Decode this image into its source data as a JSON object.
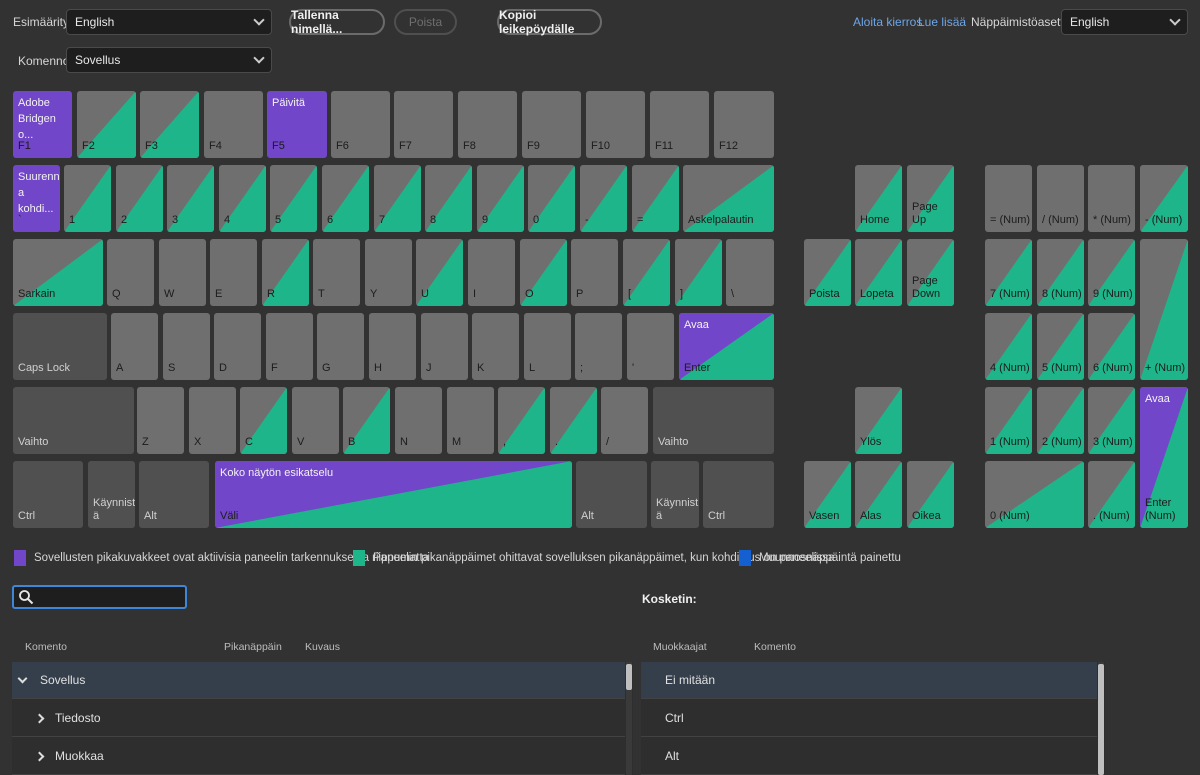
{
  "header": {
    "preset_label": "Esimääritys:",
    "preset_value": "English",
    "save_as_label": "Tallenna nimellä...",
    "delete_label": "Poista",
    "copy_label": "Kopioi leikepöydälle",
    "commands_label": "Komennot:",
    "commands_value": "Sovellus",
    "tour_link": "Aloita kierros",
    "learn_more_link": "Lue lisää",
    "layout_label": "Näppäimistöasettelu:",
    "layout_value": "English"
  },
  "colors": {
    "app_shortcut": "#7246c8",
    "panel_shortcut": "#1fb58a",
    "modifier": "#1560d0",
    "key": "#6f6f6f",
    "mod_key": "#505050"
  },
  "keyboard": {
    "keys": [
      {
        "id": "f1",
        "label": "F1",
        "command": "Adobe\nBridgen o...",
        "type": "purple"
      },
      {
        "id": "f2",
        "label": "F2",
        "type": "green-diag"
      },
      {
        "id": "f3",
        "label": "F3",
        "type": "green-diag"
      },
      {
        "id": "f4",
        "label": "F4",
        "type": "plain"
      },
      {
        "id": "f5",
        "label": "F5",
        "command": "Päivitä",
        "type": "purple"
      },
      {
        "id": "f6",
        "label": "F6",
        "type": "plain"
      },
      {
        "id": "f7",
        "label": "F7",
        "type": "plain"
      },
      {
        "id": "f8",
        "label": "F8",
        "type": "plain"
      },
      {
        "id": "f9",
        "label": "F9",
        "type": "plain"
      },
      {
        "id": "f10",
        "label": "F10",
        "type": "plain"
      },
      {
        "id": "f11",
        "label": "F11",
        "type": "plain"
      },
      {
        "id": "f12",
        "label": "F12",
        "type": "plain"
      },
      {
        "id": "backtick",
        "label": "`",
        "command": "Suurenn\na\nkohdi...",
        "type": "purple"
      },
      {
        "id": "1",
        "label": "1",
        "type": "green-diag"
      },
      {
        "id": "2",
        "label": "2",
        "type": "green-diag"
      },
      {
        "id": "3",
        "label": "3",
        "type": "green-diag"
      },
      {
        "id": "4",
        "label": "4",
        "type": "green-diag"
      },
      {
        "id": "5",
        "label": "5",
        "type": "green-diag"
      },
      {
        "id": "6",
        "label": "6",
        "type": "green-diag"
      },
      {
        "id": "7",
        "label": "7",
        "type": "green-diag"
      },
      {
        "id": "8",
        "label": "8",
        "type": "green-diag"
      },
      {
        "id": "9",
        "label": "9",
        "type": "green-diag"
      },
      {
        "id": "0",
        "label": "0",
        "type": "green-diag"
      },
      {
        "id": "minus",
        "label": "-",
        "type": "green-diag"
      },
      {
        "id": "equals",
        "label": "=",
        "type": "green-diag"
      },
      {
        "id": "backspace",
        "label": "Askelpalautin",
        "type": "green-diag"
      },
      {
        "id": "tab",
        "label": "Sarkain",
        "type": "green-diag"
      },
      {
        "id": "q",
        "label": "Q",
        "type": "plain"
      },
      {
        "id": "w",
        "label": "W",
        "type": "plain"
      },
      {
        "id": "e",
        "label": "E",
        "type": "plain"
      },
      {
        "id": "r",
        "label": "R",
        "type": "green-diag"
      },
      {
        "id": "t",
        "label": "T",
        "type": "plain"
      },
      {
        "id": "y",
        "label": "Y",
        "type": "plain"
      },
      {
        "id": "u",
        "label": "U",
        "type": "green-diag"
      },
      {
        "id": "i",
        "label": "I",
        "type": "plain"
      },
      {
        "id": "o",
        "label": "O",
        "type": "green-diag"
      },
      {
        "id": "p",
        "label": "P",
        "type": "plain"
      },
      {
        "id": "lbracket",
        "label": "[",
        "type": "green-diag"
      },
      {
        "id": "rbracket",
        "label": "]",
        "type": "green-diag"
      },
      {
        "id": "backslash",
        "label": "\\",
        "type": "plain"
      },
      {
        "id": "capslock",
        "label": "Caps Lock",
        "type": "mod"
      },
      {
        "id": "a",
        "label": "A",
        "type": "plain"
      },
      {
        "id": "s",
        "label": "S",
        "type": "plain"
      },
      {
        "id": "d",
        "label": "D",
        "type": "plain"
      },
      {
        "id": "f",
        "label": "F",
        "type": "plain"
      },
      {
        "id": "g",
        "label": "G",
        "type": "plain"
      },
      {
        "id": "h",
        "label": "H",
        "type": "plain"
      },
      {
        "id": "j",
        "label": "J",
        "type": "plain"
      },
      {
        "id": "k",
        "label": "K",
        "type": "plain"
      },
      {
        "id": "l",
        "label": "L",
        "type": "plain"
      },
      {
        "id": "semicolon",
        "label": ";",
        "type": "plain"
      },
      {
        "id": "quote",
        "label": "'",
        "type": "plain"
      },
      {
        "id": "enter",
        "label": "Enter",
        "command": "Avaa",
        "type": "purple-green"
      },
      {
        "id": "lshift",
        "label": "Vaihto",
        "type": "mod"
      },
      {
        "id": "z",
        "label": "Z",
        "type": "plain"
      },
      {
        "id": "x",
        "label": "X",
        "type": "plain"
      },
      {
        "id": "c",
        "label": "C",
        "type": "green-diag"
      },
      {
        "id": "v",
        "label": "V",
        "type": "plain"
      },
      {
        "id": "b",
        "label": "B",
        "type": "green-diag"
      },
      {
        "id": "n",
        "label": "N",
        "type": "plain"
      },
      {
        "id": "m",
        "label": "M",
        "type": "plain"
      },
      {
        "id": "comma",
        "label": ",",
        "type": "green-diag"
      },
      {
        "id": "period",
        "label": ".",
        "type": "green-diag"
      },
      {
        "id": "slash",
        "label": "/",
        "type": "plain"
      },
      {
        "id": "rshift",
        "label": "Vaihto",
        "type": "mod"
      },
      {
        "id": "lctrl",
        "label": "Ctrl",
        "type": "mod"
      },
      {
        "id": "lwin",
        "label": "Käynnist\nä",
        "type": "mod"
      },
      {
        "id": "lalt",
        "label": "Alt",
        "type": "mod"
      },
      {
        "id": "space",
        "label": "Väli",
        "command": "Koko näytön esikatselu",
        "type": "purple-green"
      },
      {
        "id": "ralt",
        "label": "Alt",
        "type": "mod"
      },
      {
        "id": "rwin",
        "label": "Käynnist\nä",
        "type": "mod"
      },
      {
        "id": "rctrl",
        "label": "Ctrl",
        "type": "mod"
      },
      {
        "id": "home",
        "label": "Home",
        "type": "green-diag"
      },
      {
        "id": "pageup",
        "label": "Page Up",
        "type": "green-diag"
      },
      {
        "id": "delete",
        "label": "Poista",
        "type": "green-diag"
      },
      {
        "id": "end",
        "label": "Lopeta",
        "type": "green-diag"
      },
      {
        "id": "pagedown",
        "label": "Page\nDown",
        "type": "green-diag"
      },
      {
        "id": "up",
        "label": "Ylös",
        "type": "green-diag"
      },
      {
        "id": "left",
        "label": "Vasen",
        "type": "green-diag"
      },
      {
        "id": "down",
        "label": "Alas",
        "type": "green-diag"
      },
      {
        "id": "right",
        "label": "Oikea",
        "type": "green-diag"
      },
      {
        "id": "num-eq",
        "label": "= (Num)",
        "type": "plain"
      },
      {
        "id": "num-div",
        "label": "/ (Num)",
        "type": "plain"
      },
      {
        "id": "num-mul",
        "label": "* (Num)",
        "type": "plain"
      },
      {
        "id": "num-sub",
        "label": "- (Num)",
        "type": "green-diag"
      },
      {
        "id": "num7",
        "label": "7 (Num)",
        "type": "green-diag"
      },
      {
        "id": "num8",
        "label": "8 (Num)",
        "type": "green-diag"
      },
      {
        "id": "num9",
        "label": "9 (Num)",
        "type": "green-diag"
      },
      {
        "id": "num-add",
        "label": "+ (Num)",
        "type": "green-diag"
      },
      {
        "id": "num4",
        "label": "4 (Num)",
        "type": "green-diag"
      },
      {
        "id": "num5",
        "label": "5 (Num)",
        "type": "green-diag"
      },
      {
        "id": "num6",
        "label": "6 (Num)",
        "type": "green-diag"
      },
      {
        "id": "num1",
        "label": "1 (Num)",
        "type": "green-diag"
      },
      {
        "id": "num2",
        "label": "2 (Num)",
        "type": "green-diag"
      },
      {
        "id": "num3",
        "label": "3 (Num)",
        "type": "green-diag"
      },
      {
        "id": "num-enter",
        "label": "Enter\n(Num)",
        "command": "Avaa",
        "type": "purple-green"
      },
      {
        "id": "num0",
        "label": "0 (Num)",
        "type": "green-diag"
      },
      {
        "id": "num-dec",
        "label": ". (Num)",
        "type": "green-diag"
      }
    ]
  },
  "legend": [
    {
      "label": "Sovellusten pikakuvakkeet ovat aktiivisia paneelin tarkennuksesta riippumatta",
      "color": "#7246c8"
    },
    {
      "label": "Paneelin pikanäppäimet ohittavat sovelluksen pikanäppäimet, kun kohdistus on paneelissa",
      "color": "#1fb58a"
    },
    {
      "label": "Muunnosnäppäintä painettu",
      "color": "#1560d0"
    }
  ],
  "search": {
    "placeholder": "",
    "value": ""
  },
  "commands_table": {
    "headers": [
      "Komento",
      "Pikanäppäin",
      "Kuvaus"
    ],
    "rows": [
      {
        "label": "Sovellus",
        "expanded": true,
        "level": 0
      },
      {
        "label": "Tiedosto",
        "expanded": false,
        "level": 1
      },
      {
        "label": "Muokkaa",
        "expanded": false,
        "level": 1
      }
    ]
  },
  "key_panel": {
    "title": "Kosketin:",
    "headers": [
      "Muokkaajat",
      "Komento"
    ],
    "rows": [
      {
        "modifier": "Ei mitään",
        "command": ""
      },
      {
        "modifier": "Ctrl",
        "command": ""
      },
      {
        "modifier": "Alt",
        "command": ""
      }
    ]
  }
}
